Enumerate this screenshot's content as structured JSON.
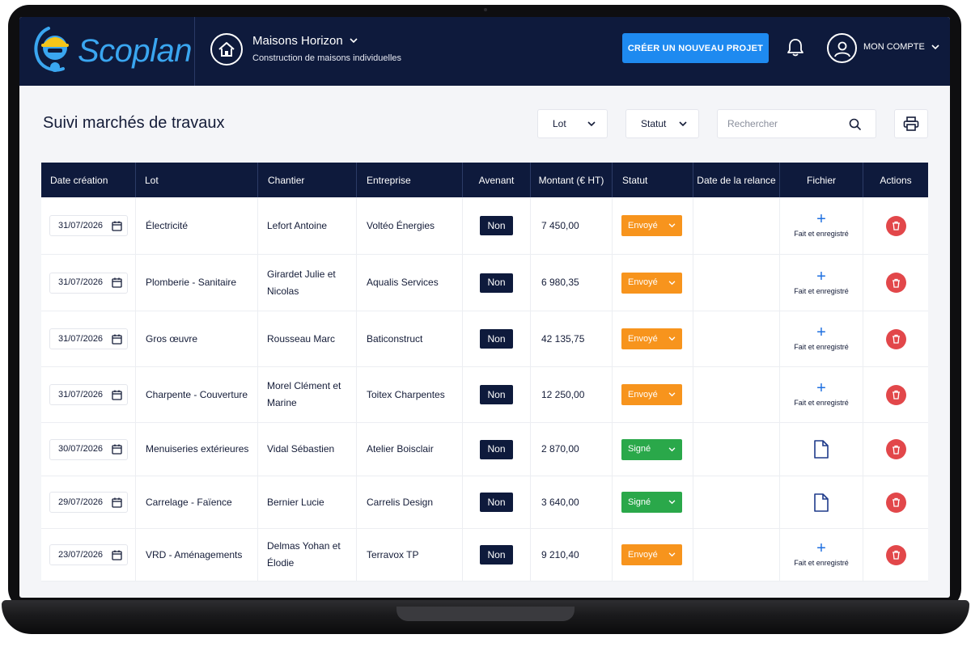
{
  "app": {
    "logo_text": "Scoplan"
  },
  "header": {
    "project_name": "Maisons Horizon",
    "project_subtitle": "Construction de maisons individuelles",
    "cta_label": "CRÉER UN NOUVEAU PROJET",
    "account_label": "MON COMPTE"
  },
  "toolbar": {
    "title": "Suivi marchés de travaux",
    "filter_lot": "Lot",
    "filter_statut": "Statut",
    "search_placeholder": "Rechercher"
  },
  "table": {
    "columns": [
      "Date création",
      "Lot",
      "Chantier",
      "Entreprise",
      "Avenant",
      "Montant (€ HT)",
      "Statut",
      "Date de la relance",
      "Fichier",
      "Actions"
    ],
    "rows": [
      {
        "date": "31/07/2026",
        "lot": "Électricité",
        "chantier": "Lefort Antoine",
        "entreprise": "Voltéo Énergies",
        "avenant": "Non",
        "montant": "7 450,00",
        "statut": "Envoyé",
        "fichier": "Fait et enregistré"
      },
      {
        "date": "31/07/2026",
        "lot": "Plomberie - Sanitaire",
        "chantier": "Girardet Julie et Nicolas",
        "entreprise": "Aqualis Services",
        "avenant": "Non",
        "montant": "6 980,35",
        "statut": "Envoyé",
        "fichier": "Fait et enregistré"
      },
      {
        "date": "31/07/2026",
        "lot": "Gros œuvre",
        "chantier": "Rousseau Marc",
        "entreprise": "Baticonstruct",
        "avenant": "Non",
        "montant": "42 135,75",
        "statut": "Envoyé",
        "fichier": "Fait et enregistré"
      },
      {
        "date": "31/07/2026",
        "lot": "Charpente - Couverture",
        "chantier": "Morel Clément et Marine",
        "entreprise": "Toitex Charpentes",
        "avenant": "Non",
        "montant": "12 250,00",
        "statut": "Envoyé",
        "fichier": "Fait et enregistré"
      },
      {
        "date": "30/07/2026",
        "lot": "Menuiseries extérieures",
        "chantier": "Vidal Sébastien",
        "entreprise": "Atelier Boisclair",
        "avenant": "Non",
        "montant": "2 870,00",
        "statut": "Signé",
        "fichier": ""
      },
      {
        "date": "29/07/2026",
        "lot": "Carrelage - Faïence",
        "chantier": "Bernier Lucie",
        "entreprise": "Carrelis Design",
        "avenant": "Non",
        "montant": "3 640,00",
        "statut": "Signé",
        "fichier": ""
      },
      {
        "date": "23/07/2026",
        "lot": "VRD - Aménagements",
        "chantier": "Delmas Yohan et Élodie",
        "entreprise": "Terravox TP",
        "avenant": "Non",
        "montant": "9 210,40",
        "statut": "Envoyé",
        "fichier": "Fait et enregistré"
      }
    ]
  },
  "icons": {
    "home": "home-icon",
    "bell": "bell-icon",
    "user": "user-icon",
    "search": "search-icon",
    "print": "printer-icon",
    "calendar": "calendar-icon",
    "plus": "plus-icon",
    "document": "document-icon",
    "trash": "trash-icon",
    "chevron": "chevron-down-icon"
  },
  "colors": {
    "navy": "#0e1a3c",
    "primary": "#1e8af0",
    "envoye": "#f7941d",
    "signe": "#2aa84a",
    "danger": "#e2474a"
  }
}
